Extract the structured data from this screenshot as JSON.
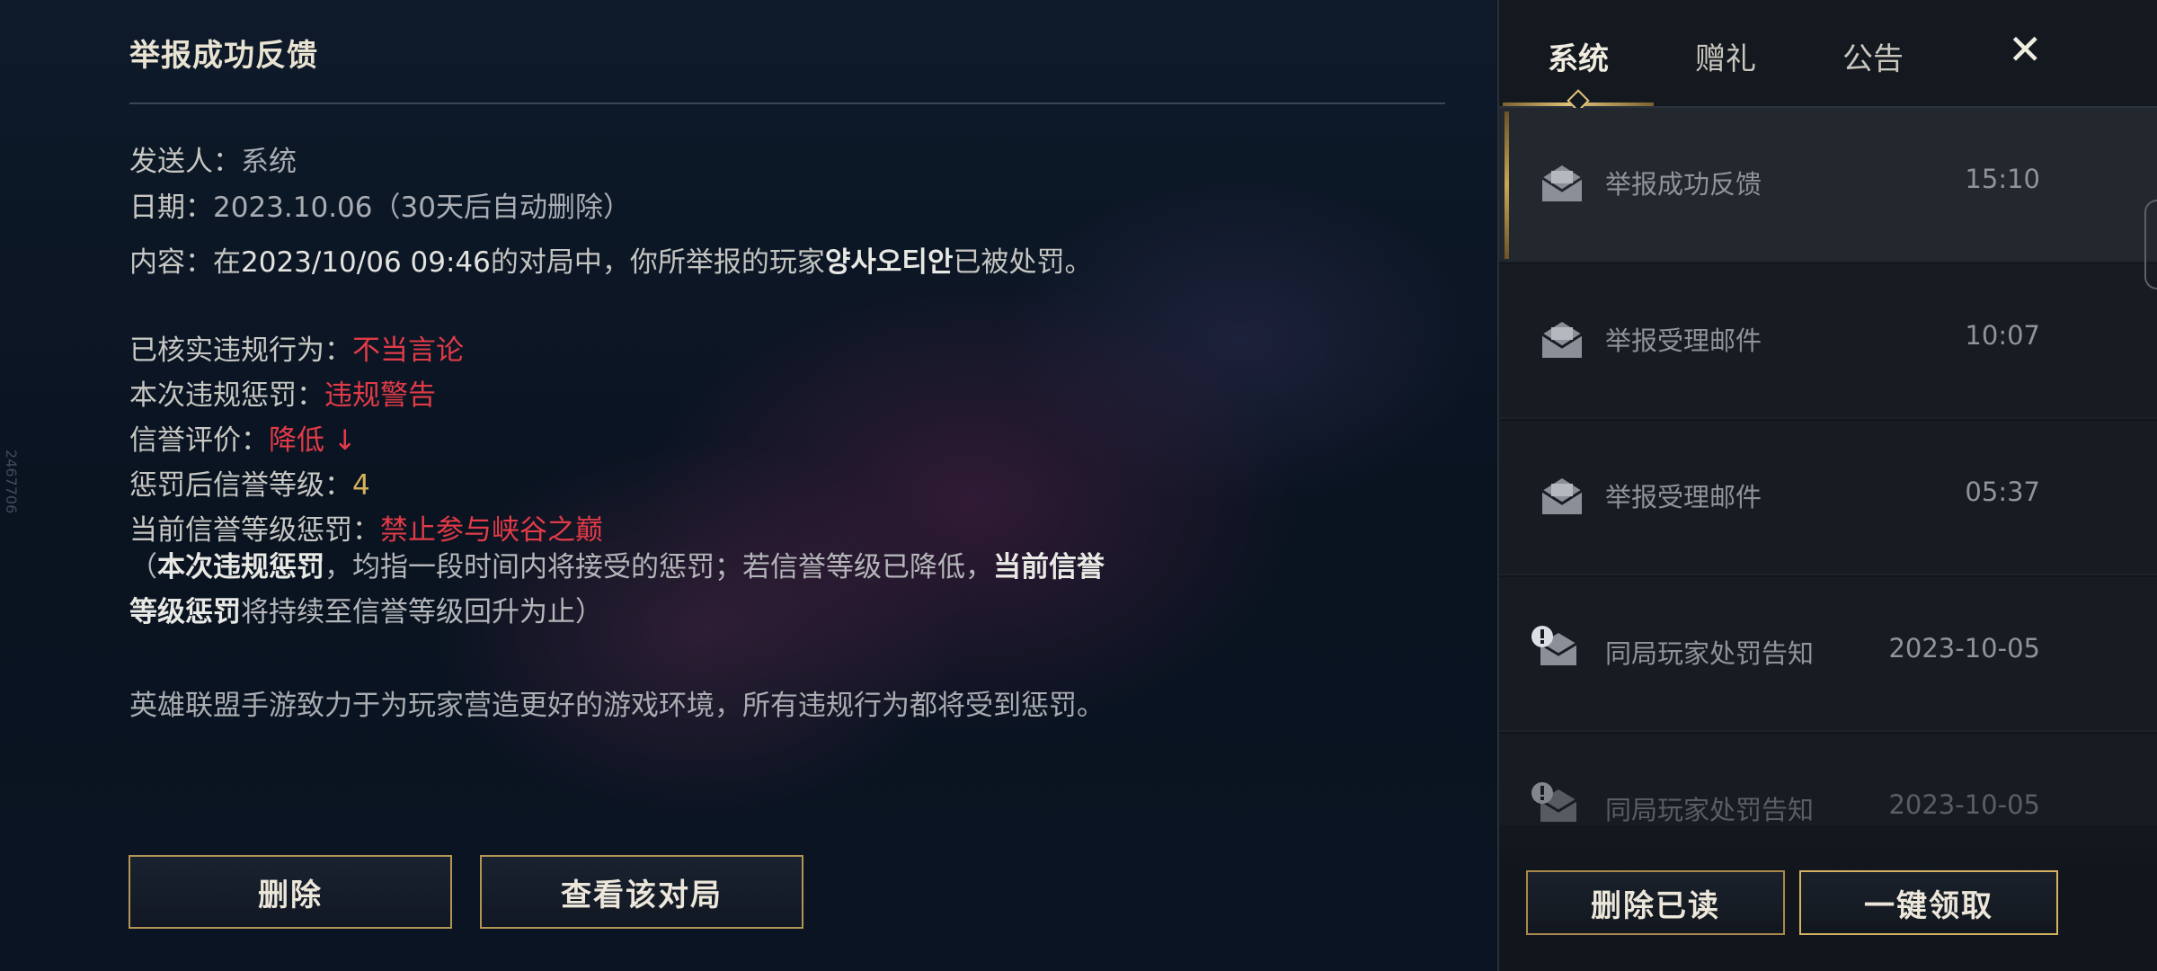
{
  "detail": {
    "title": "举报成功反馈",
    "sender_label": "发送人：",
    "sender": "系统",
    "date_label": "日期：",
    "date": "2023.10.06（30天后自动删除）",
    "content_label": "内容：",
    "content_pre": "在",
    "content_time": "2023/10/06 09:46",
    "content_mid": "的对局中，你所举报的玩家",
    "reported_player": "양사오티안",
    "content_post": "已被处罚。",
    "violation_label": "已核实违规行为：",
    "violation": "不当言论",
    "penalty_label": "本次违规惩罚：",
    "penalty": "违规警告",
    "credit_label": "信誉评价：",
    "credit": "降低 ↓",
    "credit_level_label": "惩罚后信誉等级：",
    "credit_level": "4",
    "current_penalty_label": "当前信誉等级惩罚：",
    "current_penalty": "禁止参与峡谷之巅",
    "note_open": "（",
    "note_bold1": "本次违规惩罚",
    "note_mid": "，均指一段时间内将接受的惩罚；若信誉等级已降低，",
    "note_bold2": "当前信誉等级惩罚",
    "note_end": "将持续至信誉等级回升为止）",
    "closing": "英雄联盟手游致力于为玩家营造更好的游戏环境，所有违规行为都将受到惩罚。",
    "side_number": "2467706",
    "delete_button": "删除",
    "view_match_button": "查看该对局"
  },
  "mail_panel": {
    "tabs": [
      {
        "label": "系统",
        "active": true
      },
      {
        "label": "赠礼",
        "active": false
      },
      {
        "label": "公告",
        "active": false
      }
    ],
    "close_icon": "✕",
    "items": [
      {
        "subject": "举报成功反馈",
        "time": "15:10",
        "icon": "mail-open-icon",
        "selected": true
      },
      {
        "subject": "举报受理邮件",
        "time": "10:07",
        "icon": "mail-open-icon",
        "selected": false
      },
      {
        "subject": "举报受理邮件",
        "time": "05:37",
        "icon": "mail-open-icon",
        "selected": false
      },
      {
        "subject": "同局玩家处罚告知",
        "time": "2023-10-05",
        "icon": "mail-alert-icon",
        "selected": false
      },
      {
        "subject": "同局玩家处罚告知",
        "time": "2023-10-05",
        "icon": "mail-alert-icon",
        "selected": false
      }
    ],
    "delete_read_button": "删除已读",
    "claim_all_button": "一键领取"
  },
  "colors": {
    "accent_gold": "#d6b15a",
    "penalty_red": "#e23b48",
    "panel_bg": "#12161c"
  }
}
